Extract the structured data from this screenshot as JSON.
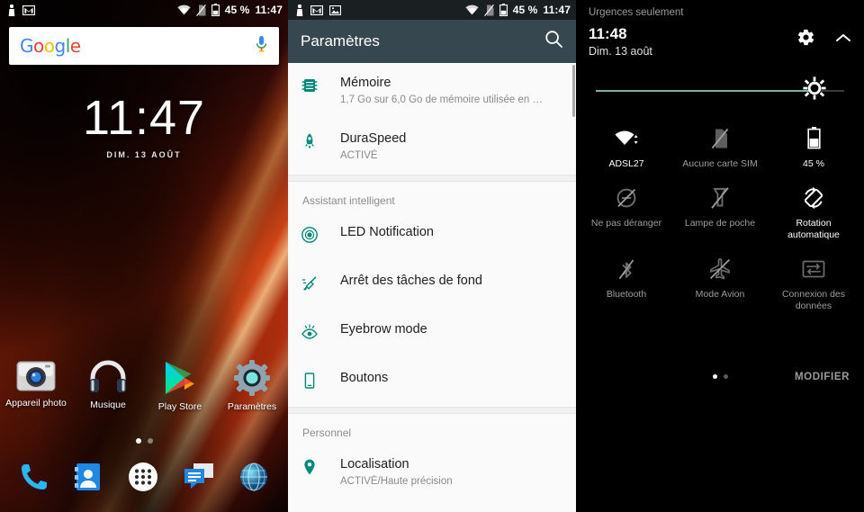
{
  "home": {
    "statusbar": {
      "left_icons": [
        "person-badge-icon",
        "gmail-icon"
      ],
      "wifi_icon": "wifi-icon",
      "sim_icon": "no-sim-icon",
      "battery_icon": "battery-icon",
      "battery_text": "45 %",
      "clock": "11:47"
    },
    "search": {
      "logo": "Google",
      "letters": [
        "G",
        "o",
        "o",
        "g",
        "l",
        "e"
      ],
      "mic_icon": "microphone-icon"
    },
    "clock_widget": {
      "time": "11:47",
      "date": "DIM. 13 AOÛT"
    },
    "apps": [
      {
        "label": "Appareil photo",
        "icon": "camera-icon"
      },
      {
        "label": "Musique",
        "icon": "headphones-icon"
      },
      {
        "label": "Play Store",
        "icon": "play-store-icon"
      },
      {
        "label": "Paramètres",
        "icon": "gear-icon"
      }
    ],
    "page_dots": {
      "count": 2,
      "active": 0
    },
    "dock": [
      {
        "label": "phone",
        "icon": "phone-icon"
      },
      {
        "label": "contacts",
        "icon": "contacts-icon"
      },
      {
        "label": "app drawer",
        "icon": "app-drawer-icon"
      },
      {
        "label": "messages",
        "icon": "messages-icon"
      },
      {
        "label": "browser",
        "icon": "browser-icon"
      }
    ]
  },
  "settings": {
    "statusbar": {
      "left_icons": [
        "person-badge-icon",
        "gmail-icon",
        "image-icon"
      ],
      "battery_text": "45 %",
      "clock": "11:47"
    },
    "appbar": {
      "title": "Paramètres",
      "search_icon": "search-icon"
    },
    "items": [
      {
        "title": "Mémoire",
        "sub": "1,7 Go sur 6,0 Go de mémoire utilisée en …",
        "icon": "memory-chip-icon"
      },
      {
        "title": "DuraSpeed",
        "sub": "ACTIVÉ",
        "icon": "rocket-icon"
      }
    ],
    "section1_header": "Assistant intelligent",
    "section1_items": [
      {
        "title": "LED Notification",
        "sub": "",
        "icon": "led-circle-icon"
      },
      {
        "title": "Arrêt des tâches de fond",
        "sub": "",
        "icon": "broom-icon"
      },
      {
        "title": "Eyebrow mode",
        "sub": "",
        "icon": "eye-icon"
      },
      {
        "title": "Boutons",
        "sub": "",
        "icon": "phone-outline-icon"
      }
    ],
    "section2_header": "Personnel",
    "section2_items": [
      {
        "title": "Localisation",
        "sub": "ACTIVÉ/Haute précision",
        "icon": "location-pin-icon"
      }
    ],
    "accent": "#00897B"
  },
  "quick": {
    "carrier": "Urgences seulement",
    "time": "11:48",
    "date": "Dim. 13 août",
    "gear_icon": "gear-icon",
    "collapse_icon": "chevron-up-icon",
    "brightness": {
      "value": 88,
      "icon": "brightness-icon",
      "fill_color": "#7fb3a8"
    },
    "tiles": [
      [
        {
          "label": "ADSL27",
          "icon": "wifi-icon",
          "state": "on"
        },
        {
          "label": "Aucune carte SIM",
          "icon": "no-sim-icon",
          "state": "off"
        },
        {
          "label": "45 %",
          "icon": "battery-icon",
          "state": "on"
        }
      ],
      [
        {
          "label": "Ne pas déranger",
          "icon": "do-not-disturb-icon",
          "state": "off"
        },
        {
          "label": "Lampe de poche",
          "icon": "flashlight-icon",
          "state": "off"
        },
        {
          "label": "Rotation automatique",
          "icon": "auto-rotate-icon",
          "state": "on"
        }
      ],
      [
        {
          "label": "Bluetooth",
          "icon": "bluetooth-off-icon",
          "state": "off"
        },
        {
          "label": "Mode Avion",
          "icon": "airplane-off-icon",
          "state": "off"
        },
        {
          "label": "Connexion des données",
          "icon": "data-connection-icon",
          "state": "off"
        }
      ]
    ],
    "page_dots": {
      "count": 2,
      "active": 0
    },
    "edit_label": "MODIFIER"
  }
}
